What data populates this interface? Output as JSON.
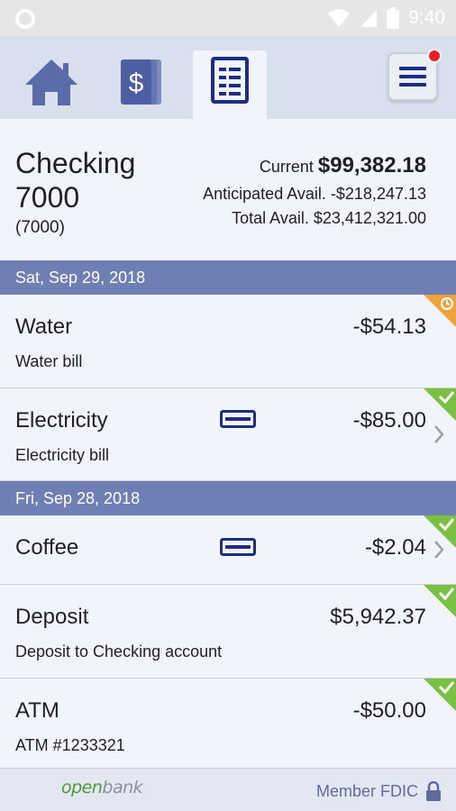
{
  "status_bar": {
    "time": "9:40"
  },
  "nav": {
    "tabs": [
      {
        "name": "home",
        "icon": "home-icon"
      },
      {
        "name": "transfer",
        "icon": "dollar-cards-icon"
      },
      {
        "name": "transactions",
        "icon": "document-list-icon"
      }
    ],
    "menu_icon": "hamburger-menu-icon"
  },
  "account": {
    "name": "Checking 7000",
    "number": "(7000)",
    "current_label": "Current",
    "current_value": "$99,382.18",
    "anticipated": "Anticipated Avail. -$218,247.13",
    "total": "Total Avail. $23,412,321.00"
  },
  "groups": [
    {
      "date": "Sat, Sep 29, 2018",
      "transactions": [
        {
          "title": "Water",
          "description": "Water bill",
          "amount": "-$54.13",
          "status": "pending"
        },
        {
          "title": "Electricity",
          "description": "Electricity bill",
          "amount": "-$85.00",
          "status": "cleared"
        }
      ]
    },
    {
      "date": "Fri, Sep 28, 2018",
      "transactions": [
        {
          "title": "Coffee",
          "description": "",
          "amount": "-$2.04",
          "status": "cleared"
        },
        {
          "title": "Deposit",
          "description": "Deposit to Checking account",
          "amount": "$5,942.37",
          "status": "cleared"
        },
        {
          "title": "ATM",
          "description": "ATM #1233321",
          "amount": "-$50.00",
          "status": "cleared"
        }
      ]
    }
  ],
  "footer": {
    "logo_open": "open",
    "logo_bank": "bank",
    "member": "Member FDIC"
  },
  "colors": {
    "accent": "#3d4d9a",
    "header_band": "#6f7fb4",
    "cleared": "#7ac143",
    "pending": "#f0a13a"
  }
}
